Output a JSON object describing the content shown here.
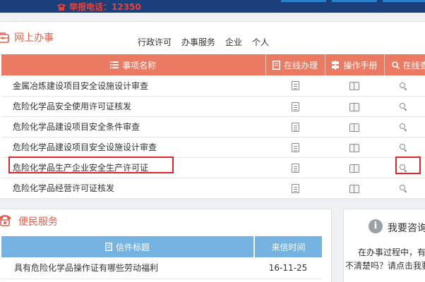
{
  "header": {
    "hotline": "举报电话：12350"
  },
  "online_affairs": {
    "title": "网上办事",
    "category_tabs": [
      "行政许可",
      "办事服务",
      "企业",
      "个人"
    ],
    "columns": {
      "name": "事项名称",
      "online": "在线办理",
      "manual": "操作手册",
      "query": "在线查"
    },
    "items": [
      "金属冶炼建设项目安全设施设计审查",
      "危险化学品安全使用许可证核发",
      "危险化学品建设项目安全条件审查",
      "危险化学品建设项目安全设施设计审查",
      "危险化学品生产企业安全生产许可证",
      "危险化学品经营许可证核发"
    ],
    "highlight_color": "#e0242b",
    "header_color": "#ea7a62"
  },
  "convenience": {
    "title": "便民服务",
    "columns": {
      "subject": "信件标题",
      "date": "来信时间"
    },
    "letters": [
      {
        "subject": "具有危险化学品操作证有哪些劳动福利",
        "date": "16-11-25"
      }
    ],
    "header_color": "#74b3e1"
  },
  "consult": {
    "title": "我要咨询",
    "line1": "在办事过程中，有",
    "line2": "不清楚吗？请点击我要"
  }
}
